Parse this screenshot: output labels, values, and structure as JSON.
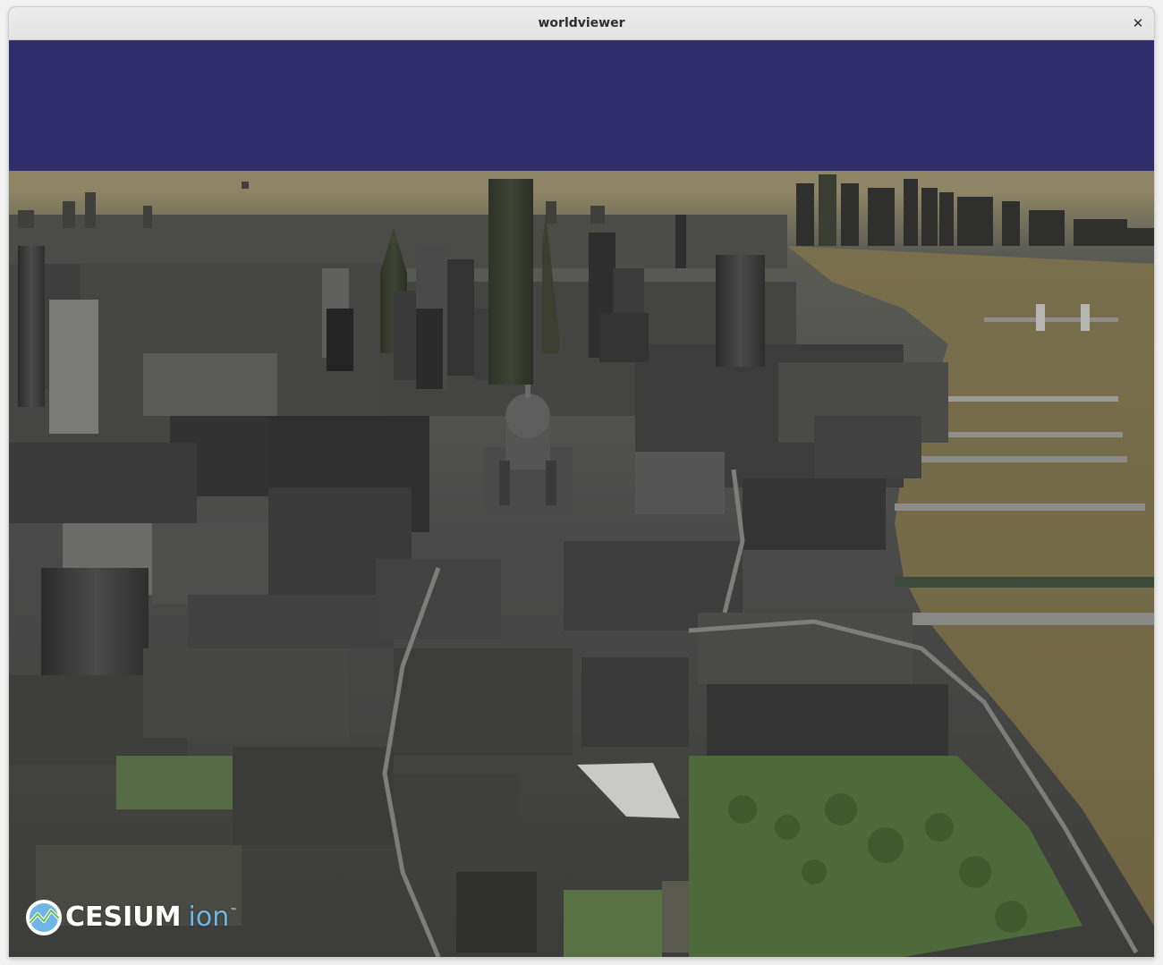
{
  "window": {
    "title": "worldviewer",
    "close_glyph": "✕"
  },
  "viewport": {
    "content": "3d-city-scene",
    "sky_color": "#312d6c",
    "river_color": "#7b6d47",
    "park_color": "#4f6a3a"
  },
  "logo": {
    "brand": "CESIUM",
    "product": "ion",
    "trademark": "™",
    "accent_color": "#6fb6e6"
  }
}
